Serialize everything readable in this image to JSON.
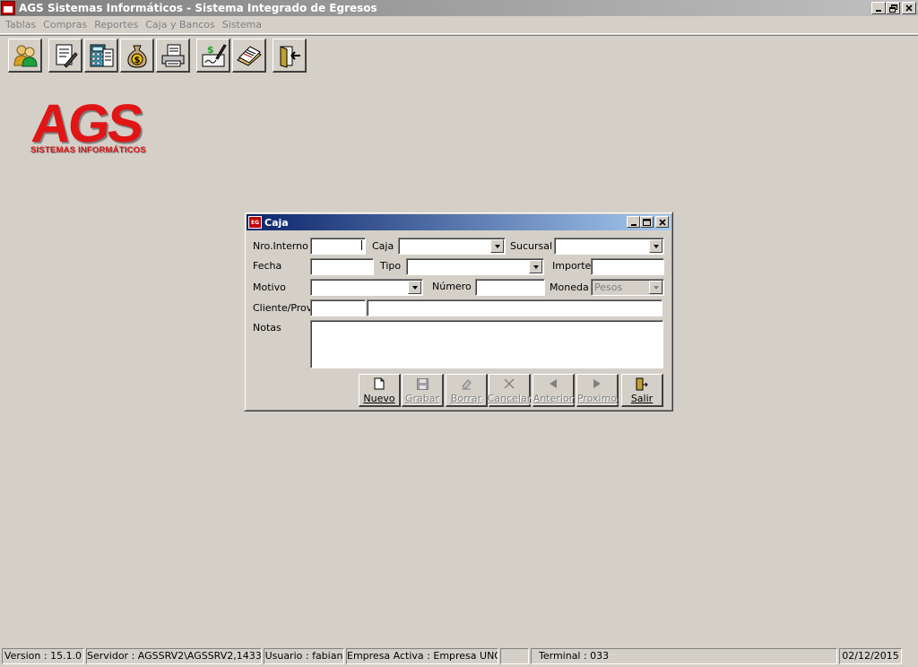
{
  "window": {
    "title": "AGS Sistemas Informáticos - Sistema Integrado de Egresos"
  },
  "menu": [
    "Tablas",
    "Compras",
    "Reportes",
    "Caja y Bancos",
    "Sistema"
  ],
  "toolbar": {
    "buttons": [
      {
        "icon": "users-icon"
      },
      {
        "icon": "document-edit-icon"
      },
      {
        "icon": "calculator-sheet-icon"
      },
      {
        "icon": "money-bag-icon"
      },
      {
        "icon": "printer-icon"
      },
      {
        "icon": "check-sign-icon"
      },
      {
        "icon": "ledger-book-icon"
      },
      {
        "icon": "exit-door-icon"
      }
    ]
  },
  "logo": {
    "main": "AGS",
    "sub": "SISTEMAS INFORMÁTICOS"
  },
  "dialog": {
    "title": "Caja",
    "icon_text": "EG",
    "labels": {
      "nro_interno": "Nro.Interno",
      "caja": "Caja",
      "sucursal": "Sucursal",
      "fecha": "Fecha",
      "tipo": "Tipo",
      "importe": "Importe",
      "motivo": "Motivo",
      "numero": "Número",
      "moneda": "Moneda",
      "cliente_prov": "Cliente/Prov.",
      "notas": "Notas"
    },
    "values": {
      "nro_interno": "",
      "caja": "",
      "sucursal": "",
      "fecha": "",
      "tipo": "",
      "importe": "",
      "motivo": "",
      "numero": "",
      "moneda": "Pesos",
      "cliente_codigo": "",
      "cliente_nombre": "",
      "notas": ""
    },
    "buttons": {
      "nuevo": "Nuevo",
      "grabar": "Grabar",
      "borrar": "Borrar",
      "cancelar": "Cancelar",
      "anterior": "Anterior",
      "proximo": "Proximo",
      "salir": "Salir"
    }
  },
  "status": {
    "version": "Version : 15.1.0",
    "servidor": "Servidor : AGSSRV2\\AGSSRV2,1433",
    "usuario": "Usuario : fabian",
    "empresa": "Empresa Activa : Empresa UNO",
    "blank": "",
    "terminal": "Terminal : 033",
    "fecha": "02/12/2015"
  },
  "colors": {
    "background": "#d4d0c8",
    "active_title_start": "#0a246a",
    "active_title_end": "#a6caf0",
    "logo_red": "#e11515"
  }
}
